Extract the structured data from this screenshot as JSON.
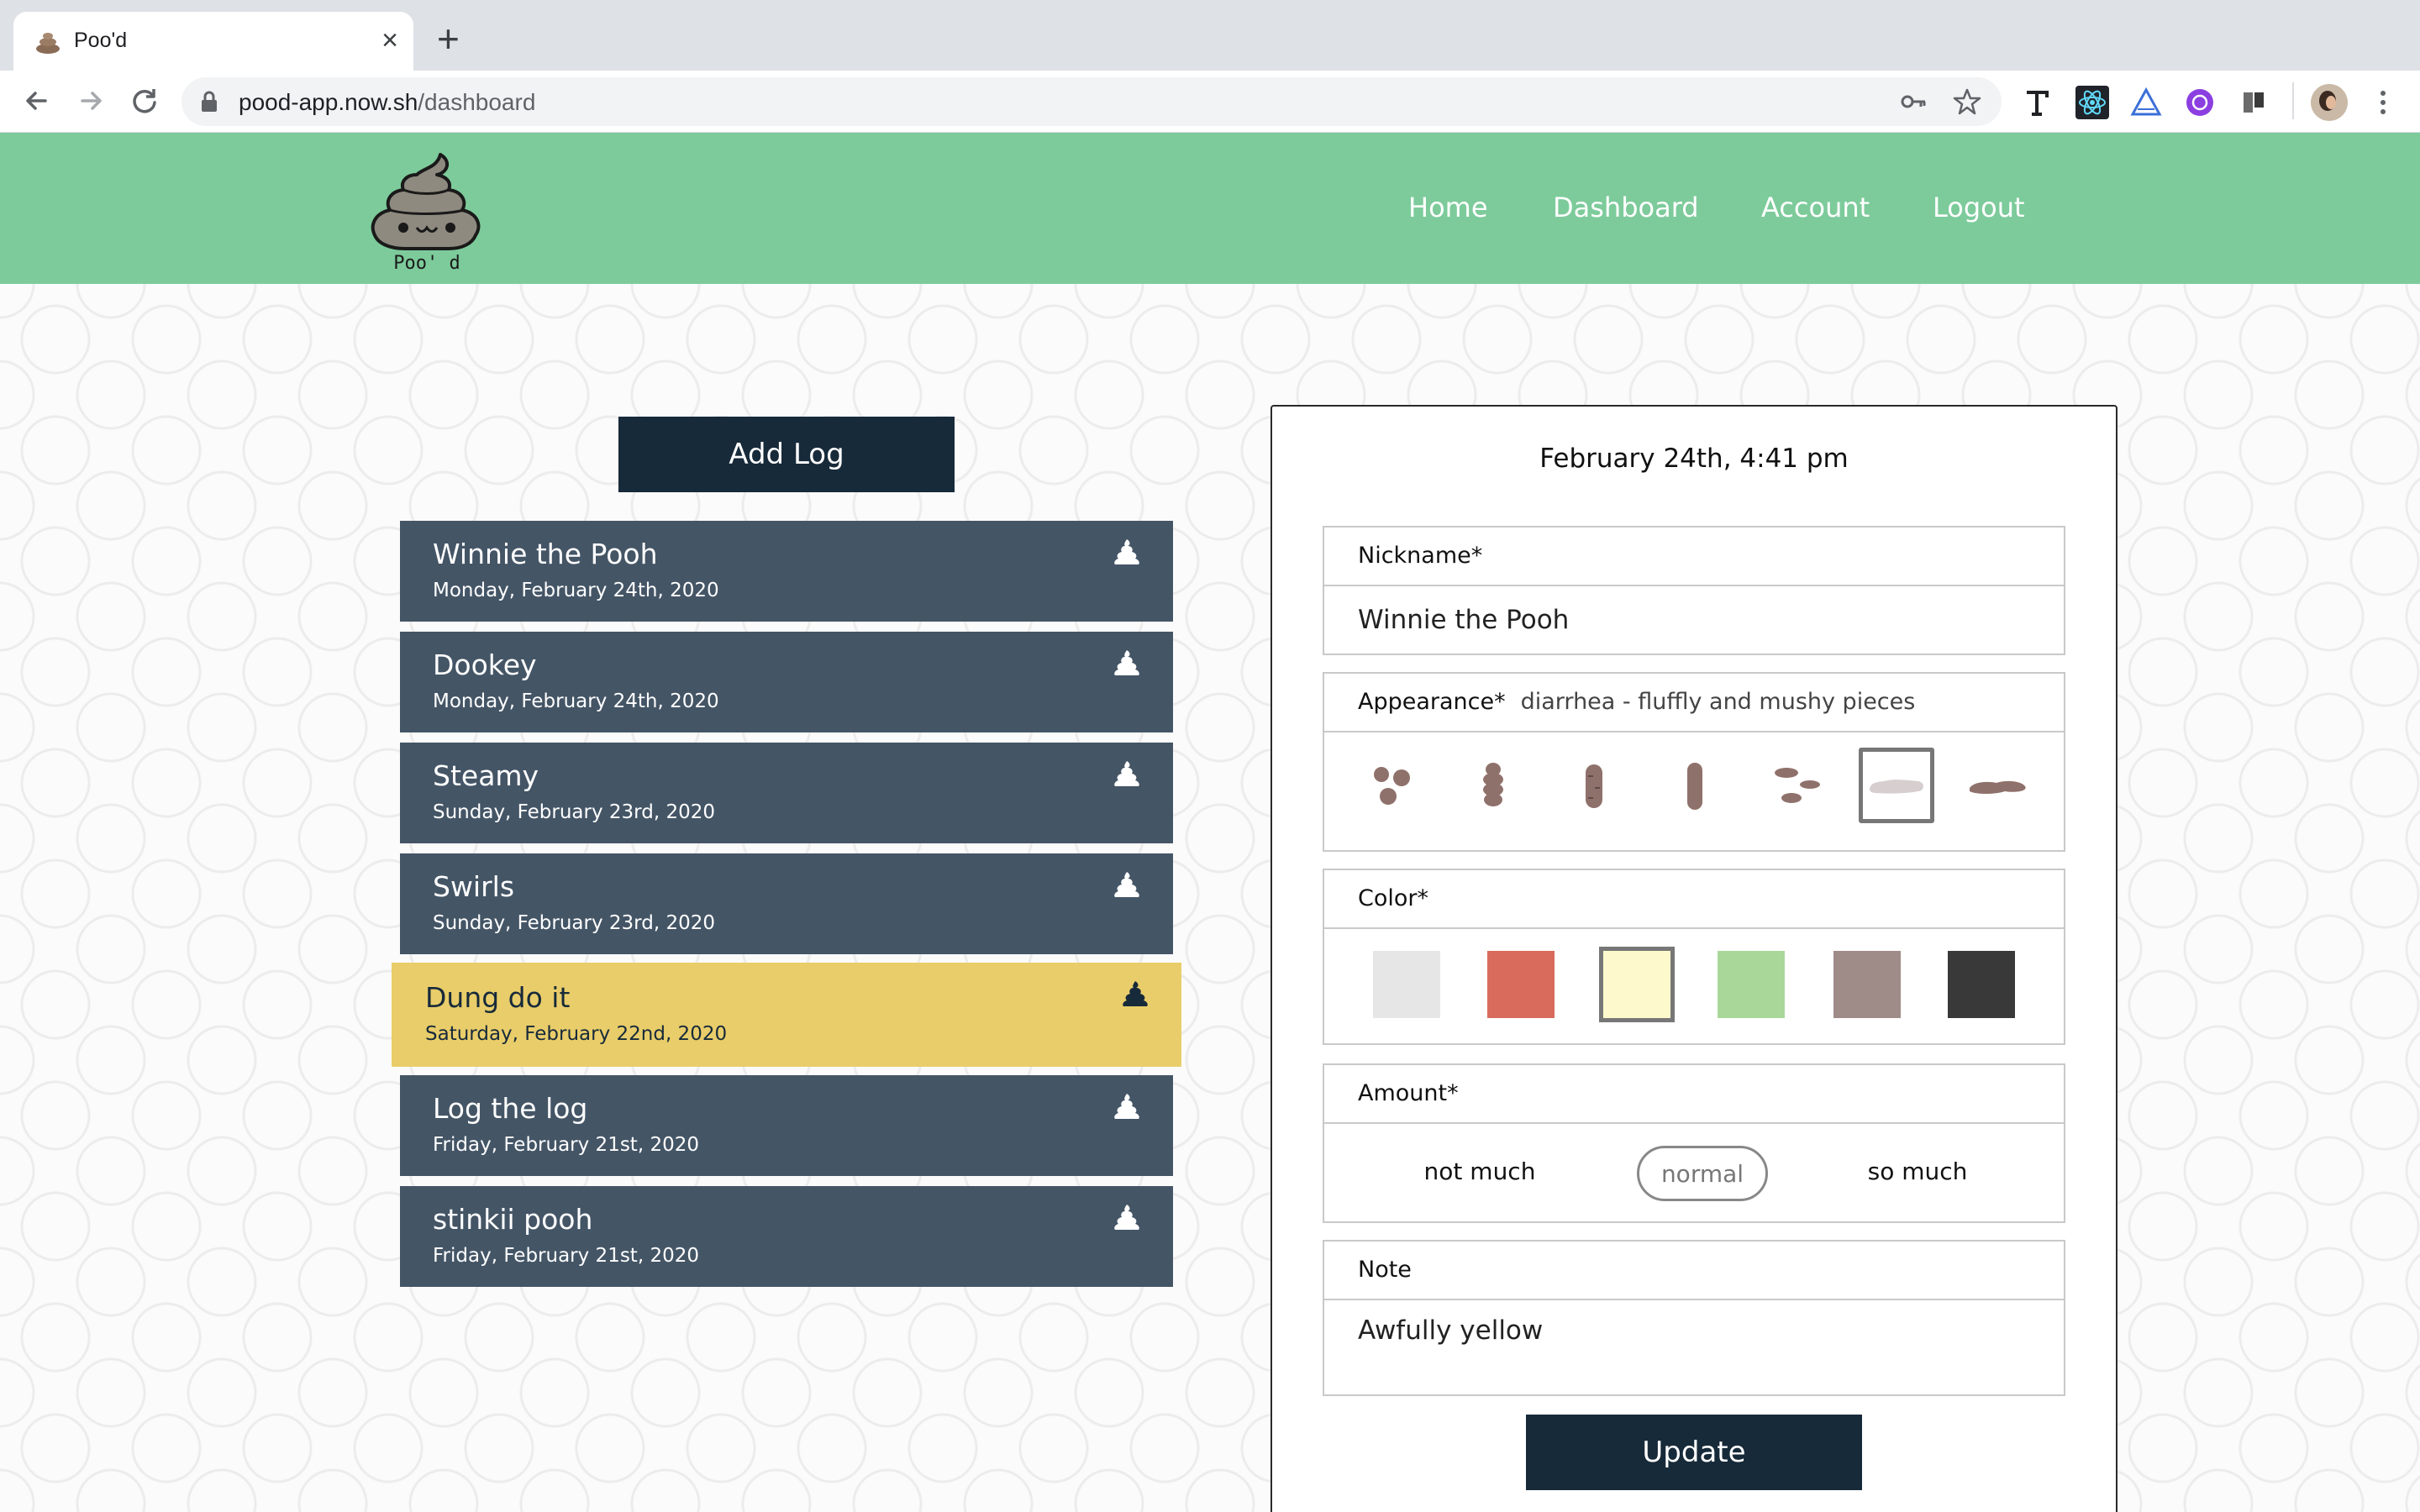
{
  "browser": {
    "tab_title": "Poo'd",
    "url_host": "pood-app.now.sh",
    "url_path": "/dashboard"
  },
  "nav": {
    "home": "Home",
    "dashboard": "Dashboard",
    "account": "Account",
    "logout": "Logout"
  },
  "logo_text": "Poo' d",
  "add_log_label": "Add Log",
  "logs": [
    {
      "name": "Winnie the Pooh",
      "date": "Monday, February 24th, 2020",
      "selected": false
    },
    {
      "name": "Dookey",
      "date": "Monday, February 24th, 2020",
      "selected": false
    },
    {
      "name": "Steamy",
      "date": "Sunday, February 23rd, 2020",
      "selected": false
    },
    {
      "name": "Swirls",
      "date": "Sunday, February 23rd, 2020",
      "selected": false
    },
    {
      "name": "Dung do it",
      "date": "Saturday, February 22nd, 2020",
      "selected": true
    },
    {
      "name": "Log the log",
      "date": "Friday, February 21st, 2020",
      "selected": false
    },
    {
      "name": "stinkii pooh",
      "date": "Friday, February 21st, 2020",
      "selected": false
    }
  ],
  "detail": {
    "datetime": "February 24th, 4:41 pm",
    "nickname_label": "Nickname*",
    "nickname_value": "Winnie the Pooh",
    "appearance_label": "Appearance*",
    "appearance_value": "diarrhea - fluffly and mushy pieces",
    "appearance_selected_index": 5,
    "color_label": "Color*",
    "colors": [
      "#e6e6e6",
      "#d86b5b",
      "#fdf9cc",
      "#a9d79a",
      "#9f8b88",
      "#393939"
    ],
    "color_selected_index": 2,
    "amount_label": "Amount*",
    "amount_options": [
      "not much",
      "normal",
      "so much"
    ],
    "amount_selected_index": 1,
    "note_label": "Note",
    "note_value": "Awfully yellow",
    "update_label": "Update"
  }
}
